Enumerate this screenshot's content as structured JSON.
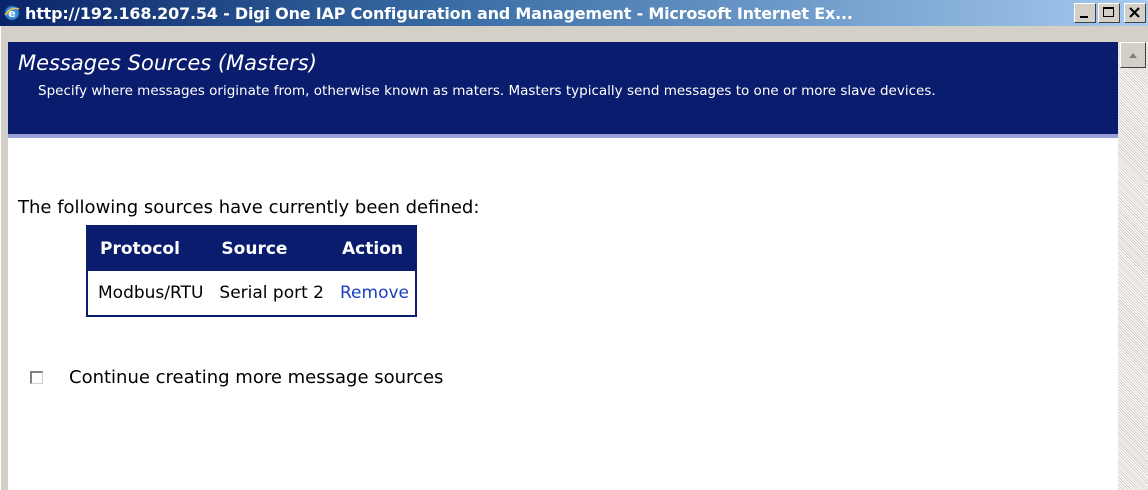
{
  "window": {
    "title": "http://192.168.207.54 - Digi One IAP Configuration and Management - Microsoft Internet Ex...",
    "icon": "ie-icon",
    "buttons": [
      "minimize-icon",
      "maximize-icon",
      "close-icon"
    ]
  },
  "header": {
    "title": "Messages Sources (Masters)",
    "description": "Specify where messages originate from, otherwise known as maters. Masters typically send messages to one or more slave devices."
  },
  "intro_text": "The following sources have currently been defined:",
  "table": {
    "columns": [
      "Protocol",
      "Source",
      "Action"
    ],
    "rows": [
      {
        "protocol": "Modbus/RTU",
        "source": "Serial port 2",
        "action": "Remove"
      }
    ]
  },
  "continue_checkbox": {
    "label": "Continue creating more message sources",
    "checked": false
  },
  "colors": {
    "header_bg": "#0a1c6e",
    "link": "#1a3fbf"
  }
}
